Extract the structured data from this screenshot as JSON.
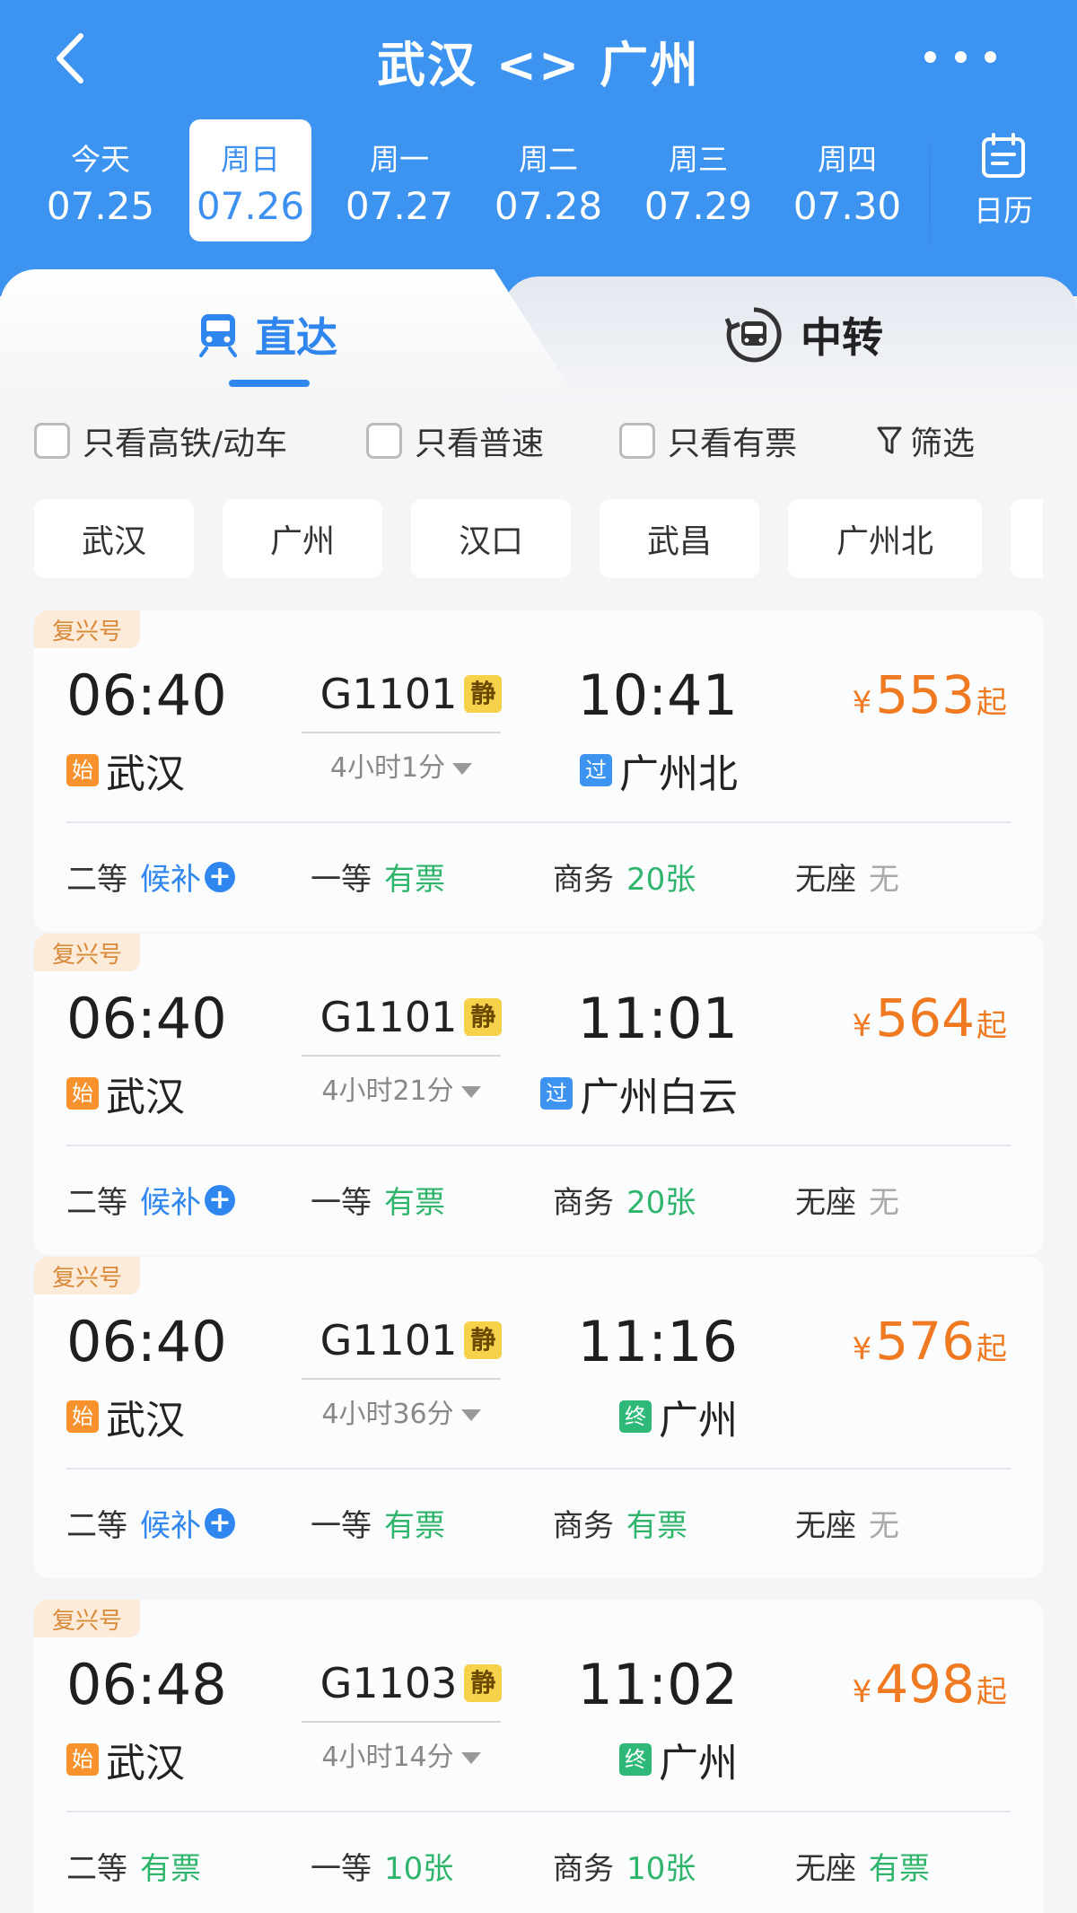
{
  "header": {
    "title": "武汉 <> 广州",
    "calendar_label": "日历"
  },
  "dates": [
    {
      "weekday": "今天",
      "date": "07.25"
    },
    {
      "weekday": "周日",
      "date": "07.26",
      "selected": true
    },
    {
      "weekday": "周一",
      "date": "07.27"
    },
    {
      "weekday": "周二",
      "date": "07.28"
    },
    {
      "weekday": "周三",
      "date": "07.29"
    },
    {
      "weekday": "周四",
      "date": "07.30"
    }
  ],
  "tabs": {
    "direct": "直达",
    "transfer": "中转"
  },
  "filters": {
    "highspeed": "只看高铁/动车",
    "normal": "只看普速",
    "available": "只看有票",
    "filter": "筛选"
  },
  "stations": [
    "武汉",
    "广州",
    "汉口",
    "武昌",
    "广州北"
  ],
  "trains": [
    {
      "badge": "复兴号",
      "dep_time": "06:40",
      "train_no": "G1101",
      "quiet": "静",
      "duration": "4小时1分",
      "arr_time": "10:41",
      "dep_tag": "始",
      "dep_station": "武汉",
      "arr_tag": "过",
      "arr_station": "广州北",
      "currency": "¥",
      "price": "553",
      "price_suffix": "起",
      "seats": [
        {
          "name": "二等",
          "status": "候补",
          "plus": "+"
        },
        {
          "name": "一等",
          "status": "有票"
        },
        {
          "name": "商务",
          "status": "20张"
        },
        {
          "name": "无座",
          "status": "无"
        }
      ]
    },
    {
      "badge": "复兴号",
      "dep_time": "06:40",
      "train_no": "G1101",
      "quiet": "静",
      "duration": "4小时21分",
      "arr_time": "11:01",
      "dep_tag": "始",
      "dep_station": "武汉",
      "arr_tag": "过",
      "arr_station": "广州白云",
      "currency": "¥",
      "price": "564",
      "price_suffix": "起",
      "seats": [
        {
          "name": "二等",
          "status": "候补",
          "plus": "+"
        },
        {
          "name": "一等",
          "status": "有票"
        },
        {
          "name": "商务",
          "status": "20张"
        },
        {
          "name": "无座",
          "status": "无"
        }
      ]
    },
    {
      "badge": "复兴号",
      "dep_time": "06:40",
      "train_no": "G1101",
      "quiet": "静",
      "duration": "4小时36分",
      "arr_time": "11:16",
      "dep_tag": "始",
      "dep_station": "武汉",
      "arr_tag": "终",
      "arr_station": "广州",
      "currency": "¥",
      "price": "576",
      "price_suffix": "起",
      "seats": [
        {
          "name": "二等",
          "status": "候补",
          "plus": "+"
        },
        {
          "name": "一等",
          "status": "有票"
        },
        {
          "name": "商务",
          "status": "有票"
        },
        {
          "name": "无座",
          "status": "无"
        }
      ]
    },
    {
      "badge": "复兴号",
      "dep_time": "06:48",
      "train_no": "G1103",
      "quiet": "静",
      "duration": "4小时14分",
      "arr_time": "11:02",
      "dep_tag": "始",
      "dep_station": "武汉",
      "arr_tag": "终",
      "arr_station": "广州",
      "currency": "¥",
      "price": "498",
      "price_suffix": "起",
      "seats": [
        {
          "name": "二等",
          "status": "有票"
        },
        {
          "name": "一等",
          "status": "10张"
        },
        {
          "name": "商务",
          "status": "10张"
        },
        {
          "name": "无座",
          "status": "有票"
        }
      ]
    }
  ]
}
